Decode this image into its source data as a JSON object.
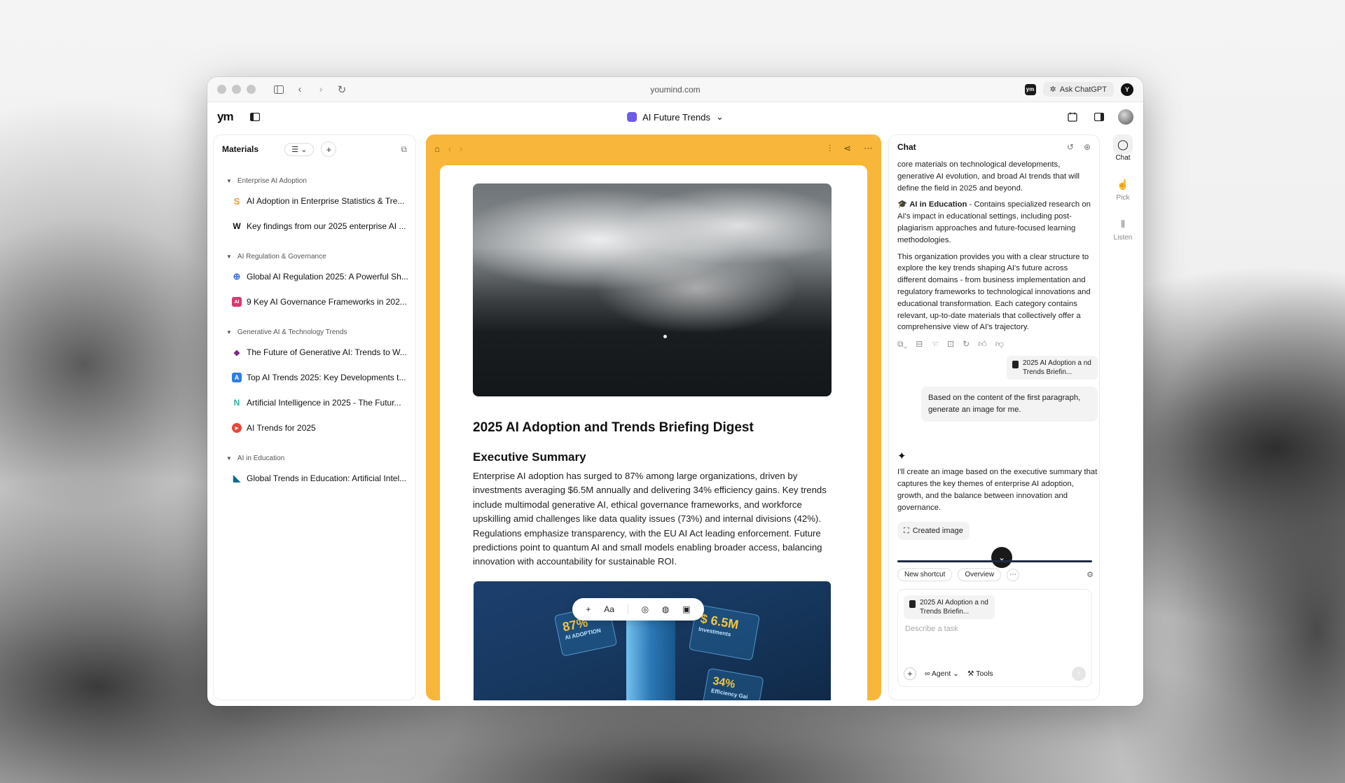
{
  "browser": {
    "url": "youmind.com",
    "ask_label": "Ask ChatGPT",
    "ext_badge": "Y",
    "ym_badge": "ym"
  },
  "header": {
    "logo": "ym",
    "doc_title": "AI Future Trends",
    "chevron": "⌄"
  },
  "materials": {
    "title": "Materials",
    "view_btn": "☰ ⌄",
    "add_btn": "+",
    "groups": [
      {
        "title": "Enterprise AI Adoption",
        "items": [
          {
            "label": "AI Adoption in Enterprise Statistics & Tre...",
            "icon": "S",
            "color": "#f29a2e"
          },
          {
            "label": "Key findings from our 2025 enterprise AI ...",
            "icon": "W",
            "color": "#111111"
          }
        ]
      },
      {
        "title": "AI Regulation & Governance",
        "items": [
          {
            "label": "Global AI Regulation 2025: A Powerful Sh...",
            "icon": "⊕",
            "color": "#3b6fd8"
          },
          {
            "label": "9 Key AI Governance Frameworks in 202...",
            "icon": "AI",
            "color": "#d63a6e"
          }
        ]
      },
      {
        "title": "Generative AI & Technology Trends",
        "items": [
          {
            "label": "The Future of Generative AI: Trends to W...",
            "icon": "◆",
            "color": "#7a2a8a"
          },
          {
            "label": "Top AI Trends 2025: Key Developments t...",
            "icon": "A",
            "color": "#2f7de1"
          },
          {
            "label": "Artificial Intelligence in 2025 - The Futur...",
            "icon": "N",
            "color": "#2eb39a"
          },
          {
            "label": "AI Trends for 2025",
            "icon": "▶",
            "color": "#e8463b"
          }
        ]
      },
      {
        "title": "AI in Education",
        "items": [
          {
            "label": "Global Trends in Education: Artificial Intel...",
            "icon": "◣",
            "color": "#0c6a8c"
          }
        ]
      }
    ]
  },
  "document": {
    "title": "2025 AI Adoption and Trends Briefing Digest",
    "section": "Executive Summary",
    "paragraph": "Enterprise AI adoption has surged to 87% among large organizations, driven by investments averaging $6.5M annually and delivering 34% efficiency gains. Key trends include multimodal generative AI, ethical governance frameworks, and workforce upskilling amid challenges like data quality issues (73%) and internal divisions (42%). Regulations emphasize transparency, with the EU AI Act leading enforcement. Future predictions point to quantum AI and small models enabling broader access, balancing innovation with accountability for sustainable ROI.",
    "infographic": {
      "tile1": "87%",
      "tile1_sub": "AI ADOPTION",
      "tile2": "$ 6.5M",
      "tile2_sub": "Investments",
      "tile3": "34%",
      "tile3_sub": "Efficiency Gai"
    },
    "float_toolbar": {
      "plus": "+",
      "text_style": "Aa"
    }
  },
  "chat": {
    "title": "Chat",
    "messages": {
      "p1": "core materials on technological developments, generative AI evolution, and broad AI trends that will define the field in 2025 and beyond.",
      "p2_icon": "🎓",
      "p2_bold": "AI in Education",
      "p2_rest": " - Contains specialized research on AI's impact in educational settings, including post-plagiarism approaches and future-focused learning methodologies.",
      "p3": "This organization provides you with a clear structure to explore the key trends shaping AI's future across different domains - from business implementation and regulatory frameworks to technological innovations and educational transformation. Each category contains relevant, up-to-date materials that collectively offer a comprehensive view of AI's trajectory.",
      "ref_chip": "2025 AI Adoption a nd Trends Briefin...",
      "user_msg": "Based on the content of the first paragraph, generate an image for me.",
      "reply": "I'll create an image based on the executive summary that captures the key themes of enterprise AI adoption, growth, and the balance between innovation and governance.",
      "created_label": "Created image"
    },
    "shortcuts": [
      "New shortcut",
      "Overview"
    ],
    "composer": {
      "ref_chip": "2025 AI Adoption a nd Trends Briefin...",
      "placeholder": "Describe a task",
      "agent_label": "∞ Agent ⌄",
      "tools_label": "Tools"
    }
  },
  "rail": {
    "items": [
      {
        "label": "Chat"
      },
      {
        "label": "Pick"
      },
      {
        "label": "Listen"
      }
    ]
  }
}
